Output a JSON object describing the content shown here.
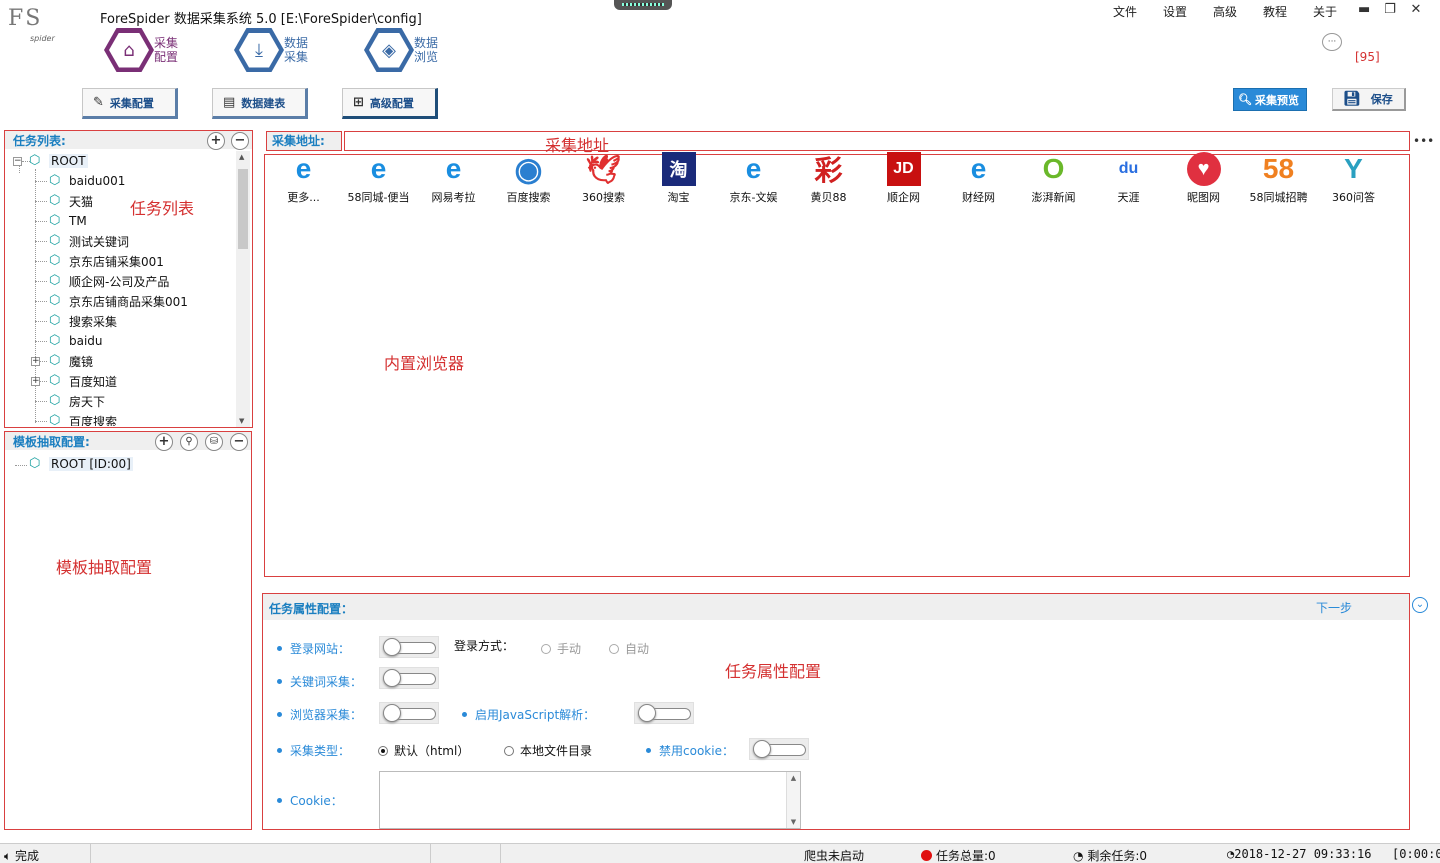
{
  "app": {
    "logo_text": "FS",
    "logo_sub": "spider",
    "title": "ForeSpider 数据采集系统  5.0  [E:\\ForeSpider\\config]"
  },
  "menu": [
    "文件",
    "设置",
    "高级",
    "教程",
    "关于"
  ],
  "window_controls": {
    "minimize": "▬",
    "restore": "❐",
    "close": "✕"
  },
  "nav": [
    {
      "line1": "采集",
      "line2": "配置",
      "icon": "home-icon"
    },
    {
      "line1": "数据",
      "line2": "采集",
      "icon": "download-icon"
    },
    {
      "line1": "数据",
      "line2": "浏览",
      "icon": "layers-icon"
    }
  ],
  "message_count": "[95]",
  "toolbar": {
    "collect_config": "采集配置",
    "data_table": "数据建表",
    "advanced_config": "高级配置",
    "preview": "采集预览",
    "save": "保存"
  },
  "task_list": {
    "title": "任务列表:",
    "items": [
      "ROOT",
      "baidu001",
      "天猫",
      "TM",
      "测试关键词",
      "京东店铺采集001",
      "顺企网-公司及产品",
      "京东店铺商品采集001",
      "搜索采集",
      "baidu",
      "魔镜",
      "百度知道",
      "房天下",
      "百度搜索"
    ]
  },
  "template_panel": {
    "title": "模板抽取配置:",
    "root": "ROOT [ID:00]"
  },
  "url_bar": {
    "label": "采集地址:",
    "value": ""
  },
  "browser_shortcuts": [
    {
      "label": "更多...",
      "icon": "ie-icon",
      "color": "#1a8ee0"
    },
    {
      "label": "58同城-便当",
      "icon": "ie-icon",
      "color": "#1a8ee0"
    },
    {
      "label": "网易考拉",
      "icon": "ie-icon",
      "color": "#1a8ee0"
    },
    {
      "label": "百度搜索",
      "icon": "globe-icon",
      "color": "#2a7fd0"
    },
    {
      "label": "360搜索",
      "icon": "bird-icon",
      "color": "#e03030"
    },
    {
      "label": "淘宝",
      "icon": "taobao-icon",
      "color": "#1a2a7a"
    },
    {
      "label": "京东-文娱",
      "icon": "ie-icon",
      "color": "#1a8ee0"
    },
    {
      "label": "黄贝88",
      "icon": "lottery-icon",
      "color": "#d02020"
    },
    {
      "label": "顺企网",
      "icon": "jd-icon",
      "color": "#c81010"
    },
    {
      "label": "财经网",
      "icon": "ie-icon",
      "color": "#1a8ee0"
    },
    {
      "label": "澎湃新闻",
      "icon": "ring-icon",
      "color": "#6ab82a"
    },
    {
      "label": "天涯",
      "icon": "paw-icon",
      "color": "#2a6ee0"
    },
    {
      "label": "昵图网",
      "icon": "heart-icon",
      "color": "#e03040"
    },
    {
      "label": "58同城招聘",
      "icon": "58-icon",
      "color": "#f08020"
    },
    {
      "label": "360问答",
      "icon": "y-icon",
      "color": "#2aa0c0"
    }
  ],
  "overlay_labels": {
    "url": "采集地址",
    "task_list": "任务列表",
    "browser": "内置浏览器",
    "template": "模板抽取配置",
    "attributes": "任务属性配置"
  },
  "attributes": {
    "title": "任务属性配置：",
    "next_step": "下一步",
    "login_site": "登录网站：",
    "login_method": "登录方式：",
    "manual": "手动",
    "auto": "自动",
    "keyword": "关键词采集：",
    "browser": "浏览器采集：",
    "js": "启用JavaScript解析：",
    "collect_type": "采集类型：",
    "type_default": "默认（html）",
    "type_local": "本地文件目录",
    "disable_cookie": "禁用cookie：",
    "cookie": "Cookie："
  },
  "status": {
    "done": "完成",
    "crawler": "爬虫未启动",
    "total": "任务总量:0",
    "remaining": "剩余任务:0",
    "datetime": "2018-12-27 09:33:16",
    "elapsed": "[0:00:0"
  }
}
